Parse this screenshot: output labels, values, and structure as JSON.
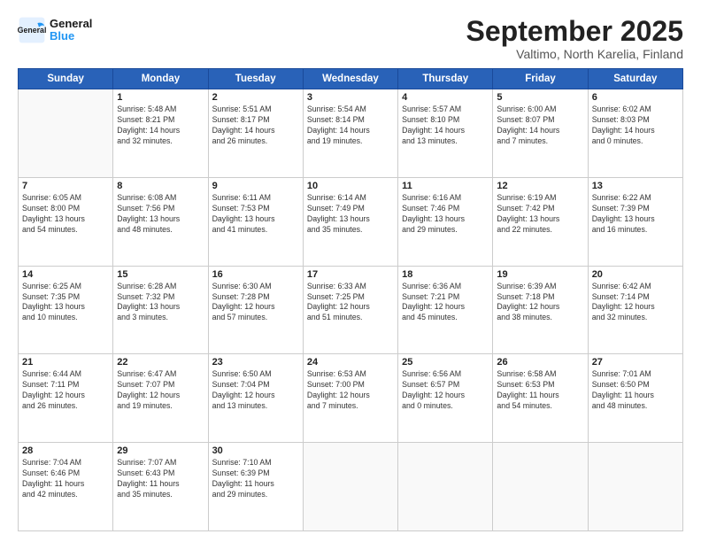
{
  "header": {
    "logo_line1": "General",
    "logo_line2": "Blue",
    "month": "September 2025",
    "location": "Valtimo, North Karelia, Finland"
  },
  "weekdays": [
    "Sunday",
    "Monday",
    "Tuesday",
    "Wednesday",
    "Thursday",
    "Friday",
    "Saturday"
  ],
  "weeks": [
    [
      {
        "day": "",
        "info": ""
      },
      {
        "day": "1",
        "info": "Sunrise: 5:48 AM\nSunset: 8:21 PM\nDaylight: 14 hours\nand 32 minutes."
      },
      {
        "day": "2",
        "info": "Sunrise: 5:51 AM\nSunset: 8:17 PM\nDaylight: 14 hours\nand 26 minutes."
      },
      {
        "day": "3",
        "info": "Sunrise: 5:54 AM\nSunset: 8:14 PM\nDaylight: 14 hours\nand 19 minutes."
      },
      {
        "day": "4",
        "info": "Sunrise: 5:57 AM\nSunset: 8:10 PM\nDaylight: 14 hours\nand 13 minutes."
      },
      {
        "day": "5",
        "info": "Sunrise: 6:00 AM\nSunset: 8:07 PM\nDaylight: 14 hours\nand 7 minutes."
      },
      {
        "day": "6",
        "info": "Sunrise: 6:02 AM\nSunset: 8:03 PM\nDaylight: 14 hours\nand 0 minutes."
      }
    ],
    [
      {
        "day": "7",
        "info": "Sunrise: 6:05 AM\nSunset: 8:00 PM\nDaylight: 13 hours\nand 54 minutes."
      },
      {
        "day": "8",
        "info": "Sunrise: 6:08 AM\nSunset: 7:56 PM\nDaylight: 13 hours\nand 48 minutes."
      },
      {
        "day": "9",
        "info": "Sunrise: 6:11 AM\nSunset: 7:53 PM\nDaylight: 13 hours\nand 41 minutes."
      },
      {
        "day": "10",
        "info": "Sunrise: 6:14 AM\nSunset: 7:49 PM\nDaylight: 13 hours\nand 35 minutes."
      },
      {
        "day": "11",
        "info": "Sunrise: 6:16 AM\nSunset: 7:46 PM\nDaylight: 13 hours\nand 29 minutes."
      },
      {
        "day": "12",
        "info": "Sunrise: 6:19 AM\nSunset: 7:42 PM\nDaylight: 13 hours\nand 22 minutes."
      },
      {
        "day": "13",
        "info": "Sunrise: 6:22 AM\nSunset: 7:39 PM\nDaylight: 13 hours\nand 16 minutes."
      }
    ],
    [
      {
        "day": "14",
        "info": "Sunrise: 6:25 AM\nSunset: 7:35 PM\nDaylight: 13 hours\nand 10 minutes."
      },
      {
        "day": "15",
        "info": "Sunrise: 6:28 AM\nSunset: 7:32 PM\nDaylight: 13 hours\nand 3 minutes."
      },
      {
        "day": "16",
        "info": "Sunrise: 6:30 AM\nSunset: 7:28 PM\nDaylight: 12 hours\nand 57 minutes."
      },
      {
        "day": "17",
        "info": "Sunrise: 6:33 AM\nSunset: 7:25 PM\nDaylight: 12 hours\nand 51 minutes."
      },
      {
        "day": "18",
        "info": "Sunrise: 6:36 AM\nSunset: 7:21 PM\nDaylight: 12 hours\nand 45 minutes."
      },
      {
        "day": "19",
        "info": "Sunrise: 6:39 AM\nSunset: 7:18 PM\nDaylight: 12 hours\nand 38 minutes."
      },
      {
        "day": "20",
        "info": "Sunrise: 6:42 AM\nSunset: 7:14 PM\nDaylight: 12 hours\nand 32 minutes."
      }
    ],
    [
      {
        "day": "21",
        "info": "Sunrise: 6:44 AM\nSunset: 7:11 PM\nDaylight: 12 hours\nand 26 minutes."
      },
      {
        "day": "22",
        "info": "Sunrise: 6:47 AM\nSunset: 7:07 PM\nDaylight: 12 hours\nand 19 minutes."
      },
      {
        "day": "23",
        "info": "Sunrise: 6:50 AM\nSunset: 7:04 PM\nDaylight: 12 hours\nand 13 minutes."
      },
      {
        "day": "24",
        "info": "Sunrise: 6:53 AM\nSunset: 7:00 PM\nDaylight: 12 hours\nand 7 minutes."
      },
      {
        "day": "25",
        "info": "Sunrise: 6:56 AM\nSunset: 6:57 PM\nDaylight: 12 hours\nand 0 minutes."
      },
      {
        "day": "26",
        "info": "Sunrise: 6:58 AM\nSunset: 6:53 PM\nDaylight: 11 hours\nand 54 minutes."
      },
      {
        "day": "27",
        "info": "Sunrise: 7:01 AM\nSunset: 6:50 PM\nDaylight: 11 hours\nand 48 minutes."
      }
    ],
    [
      {
        "day": "28",
        "info": "Sunrise: 7:04 AM\nSunset: 6:46 PM\nDaylight: 11 hours\nand 42 minutes."
      },
      {
        "day": "29",
        "info": "Sunrise: 7:07 AM\nSunset: 6:43 PM\nDaylight: 11 hours\nand 35 minutes."
      },
      {
        "day": "30",
        "info": "Sunrise: 7:10 AM\nSunset: 6:39 PM\nDaylight: 11 hours\nand 29 minutes."
      },
      {
        "day": "",
        "info": ""
      },
      {
        "day": "",
        "info": ""
      },
      {
        "day": "",
        "info": ""
      },
      {
        "day": "",
        "info": ""
      }
    ]
  ]
}
